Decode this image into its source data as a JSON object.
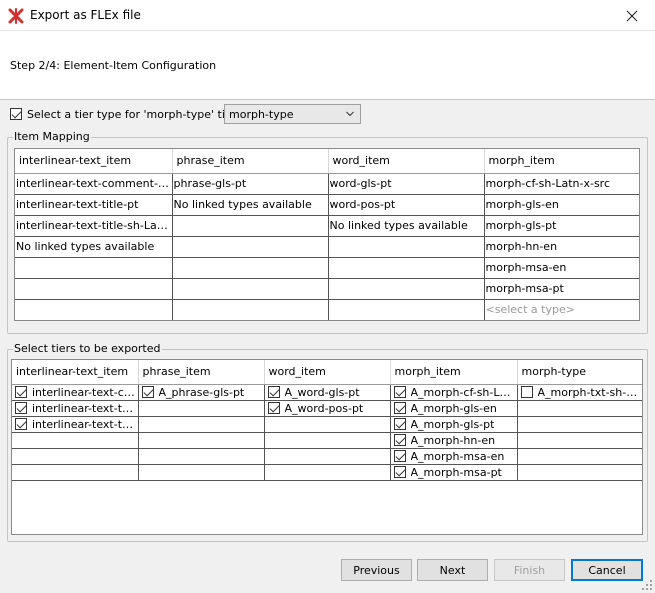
{
  "window": {
    "title": "Export as FLEx file",
    "app_icon": "elan-logo-icon",
    "close_icon": "close-icon"
  },
  "header": {
    "step": "Step 2/4: Element-Item Configuration"
  },
  "tier_type": {
    "checked": true,
    "label": "Select a tier type for 'morph-type' tiers",
    "selected": "morph-type"
  },
  "item_mapping": {
    "legend": "Item Mapping",
    "columns": [
      "interlinear-text_item",
      "phrase_item",
      "word_item",
      "morph_item"
    ],
    "rows": [
      [
        "interlinear-text-comment-sh-Latn-x-src",
        "phrase-gls-pt",
        "word-gls-pt",
        "morph-cf-sh-Latn-x-src"
      ],
      [
        "interlinear-text-title-pt",
        "No linked types available",
        "word-pos-pt",
        "morph-gls-en"
      ],
      [
        "interlinear-text-title-sh-Latn-x-src",
        "",
        "No linked types available",
        "morph-gls-pt"
      ],
      [
        "No linked types available",
        "",
        "",
        "morph-hn-en"
      ],
      [
        "",
        "",
        "",
        "morph-msa-en"
      ],
      [
        "",
        "",
        "",
        "morph-msa-pt"
      ],
      [
        "",
        "",
        "",
        "<select a type>"
      ]
    ]
  },
  "tiers": {
    "legend": "Select tiers to be exported",
    "columns": [
      "interlinear-text_item",
      "phrase_item",
      "word_item",
      "morph_item",
      "morph-type"
    ],
    "rows": [
      [
        {
          "label": "interlinear-text-comment-sh-Latn-x-src",
          "checked": true
        },
        {
          "label": "A_phrase-gls-pt",
          "checked": true
        },
        {
          "label": "A_word-gls-pt",
          "checked": true
        },
        {
          "label": "A_morph-cf-sh-Latn-x-src",
          "checked": true
        },
        {
          "label": "A_morph-txt-sh-Latn-x-src",
          "checked": false
        }
      ],
      [
        {
          "label": "interlinear-text-title-pt",
          "checked": true
        },
        null,
        {
          "label": "A_word-pos-pt",
          "checked": true
        },
        {
          "label": "A_morph-gls-en",
          "checked": true
        },
        null
      ],
      [
        {
          "label": "interlinear-text-title-sh-Latn-x-src",
          "checked": true
        },
        null,
        null,
        {
          "label": "A_morph-gls-pt",
          "checked": true
        },
        null
      ],
      [
        null,
        null,
        null,
        {
          "label": "A_morph-hn-en",
          "checked": true
        },
        null
      ],
      [
        null,
        null,
        null,
        {
          "label": "A_morph-msa-en",
          "checked": true
        },
        null
      ],
      [
        null,
        null,
        null,
        {
          "label": "A_morph-msa-pt",
          "checked": true
        },
        null
      ]
    ]
  },
  "buttons": {
    "previous": "Previous",
    "next": "Next",
    "finish": "Finish",
    "cancel": "Cancel"
  },
  "colors": {
    "accent": "#0078d7",
    "placeholder": "#999999"
  }
}
